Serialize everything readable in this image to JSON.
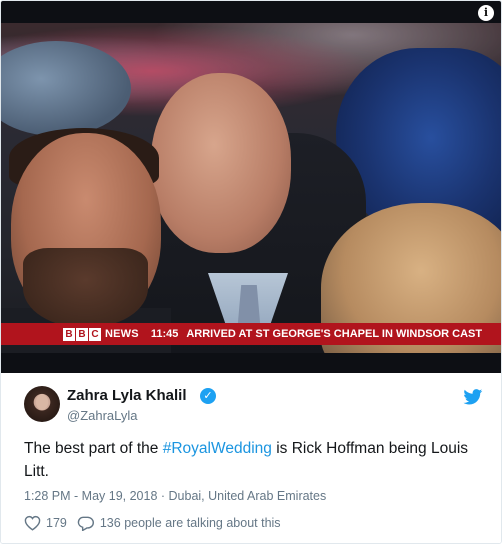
{
  "media": {
    "ticker": {
      "bbc_letters": [
        "B",
        "B",
        "C"
      ],
      "news_label": "NEWS",
      "time": "11:45",
      "headline": "ARRIVED AT ST GEORGE'S CHAPEL IN WINDSOR CAST"
    },
    "info_glyph": "i"
  },
  "tweet": {
    "display_name": "Zahra Lyla Khalil",
    "verified_glyph": "✓",
    "handle": "@ZahraLyla",
    "text_before": "The best part of the ",
    "hashtag": "#RoyalWedding",
    "text_after": " is Rick Hoffman being Louis Litt.",
    "timestamp": "1:28 PM - May 19, 2018",
    "separator": " · ",
    "location": "Dubai, United Arab Emirates",
    "like_count": "179",
    "talking_text": "136 people are talking about this",
    "colors": {
      "link": "#1b95e0",
      "verified": "#1da1f2",
      "bbc_red": "#b1141d"
    },
    "icons": [
      "verified-badge-icon",
      "twitter-bird-icon",
      "heart-icon",
      "reply-bubble-icon",
      "info-icon"
    ]
  }
}
